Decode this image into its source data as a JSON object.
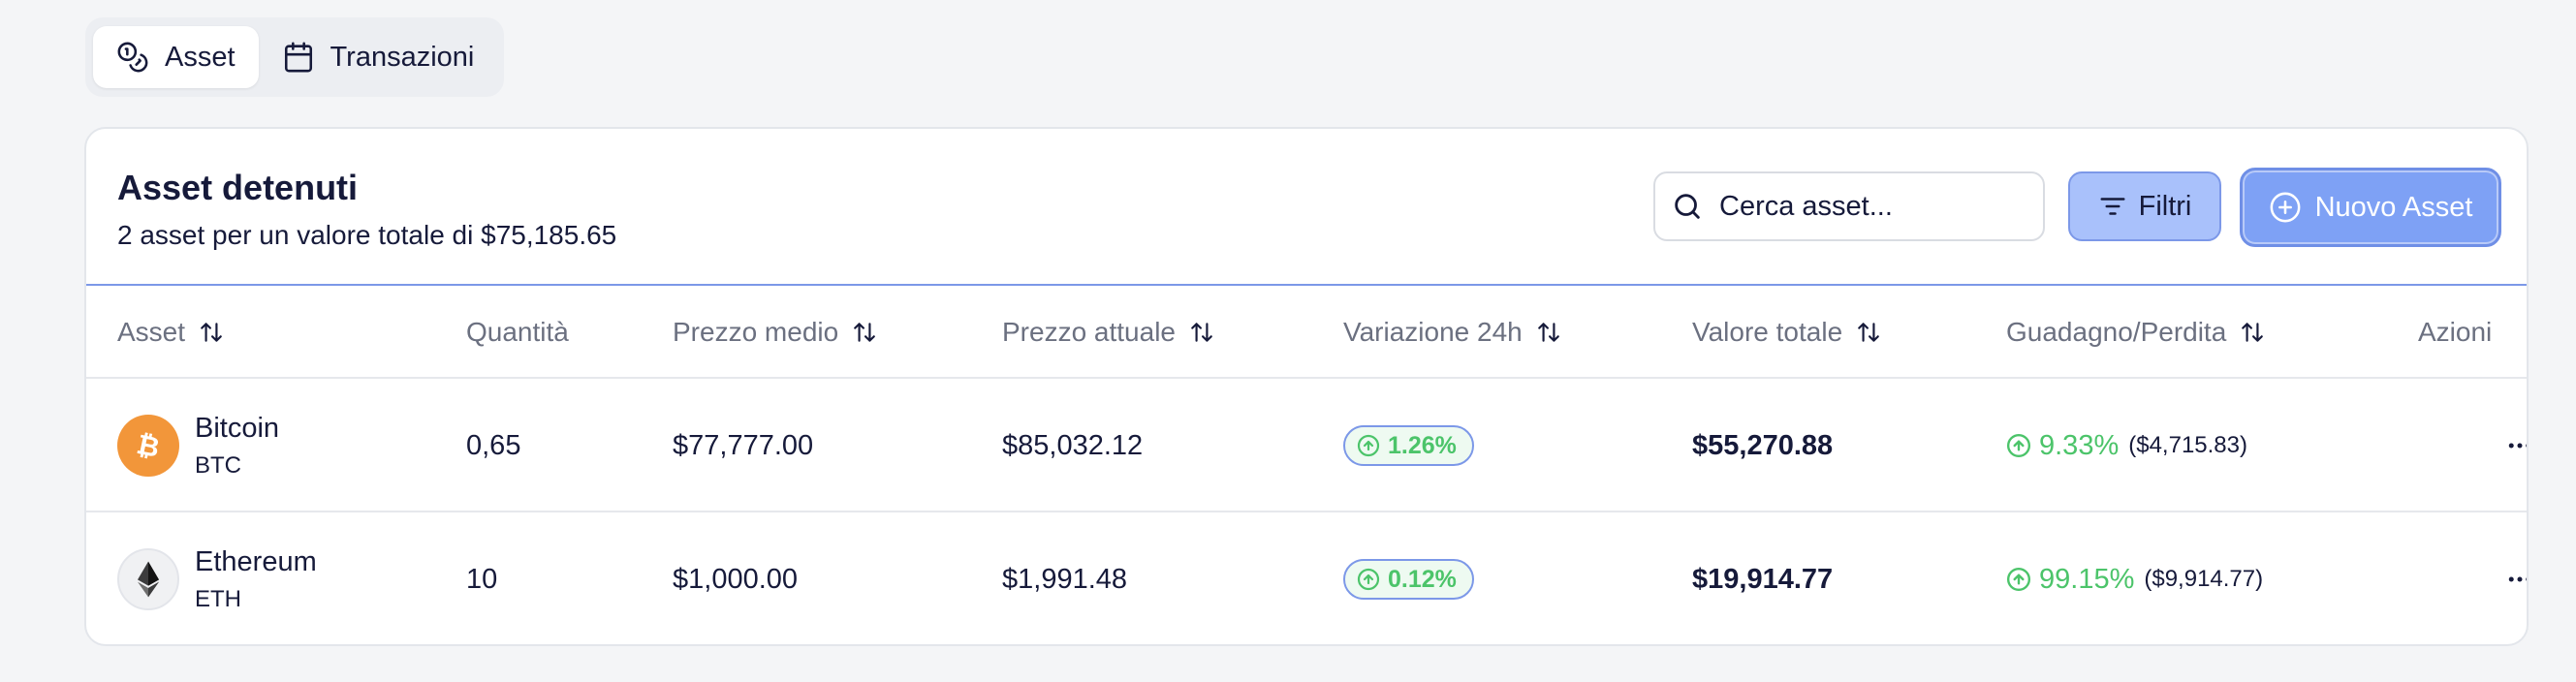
{
  "tabs": [
    {
      "label": "Asset",
      "icon": "coins-icon",
      "active": true
    },
    {
      "label": "Transazioni",
      "icon": "calendar-icon",
      "active": false
    }
  ],
  "card": {
    "title": "Asset detenuti",
    "subtitle": "2 asset per un valore totale di $75,185.65"
  },
  "search": {
    "placeholder": "Cerca asset...",
    "value": "",
    "icon": "search-icon"
  },
  "filter_button": {
    "label": "Filtri",
    "icon": "filter-icon"
  },
  "new_button": {
    "label": "Nuovo Asset",
    "icon": "plus-circle-icon"
  },
  "table": {
    "headers": {
      "asset": "Asset",
      "quantity": "Quantità",
      "avg_price": "Prezzo medio",
      "current_price": "Prezzo attuale",
      "change_24h": "Variazione 24h",
      "total_value": "Valore totale",
      "gain_loss": "Guadagno/Perdita",
      "actions": "Azioni"
    },
    "rows": [
      {
        "name": "Bitcoin",
        "symbol": "BTC",
        "icon": "bitcoin-icon",
        "quantity": "0,65",
        "avg_price": "$77,777.00",
        "current_price": "$85,032.12",
        "change_24h": "1.26%",
        "total_value": "$55,270.88",
        "gain_pct": "9.33%",
        "gain_abs": "($4,715.83)"
      },
      {
        "name": "Ethereum",
        "symbol": "ETH",
        "icon": "ethereum-icon",
        "quantity": "10",
        "avg_price": "$1,000.00",
        "current_price": "$1,991.48",
        "change_24h": "0.12%",
        "total_value": "$19,914.77",
        "gain_pct": "99.15%",
        "gain_abs": "($9,914.77)"
      }
    ]
  },
  "colors": {
    "accent": "#7ea1f5",
    "positive": "#4cc46a",
    "bitcoin": "#f2963a",
    "text": "#161a3a"
  }
}
